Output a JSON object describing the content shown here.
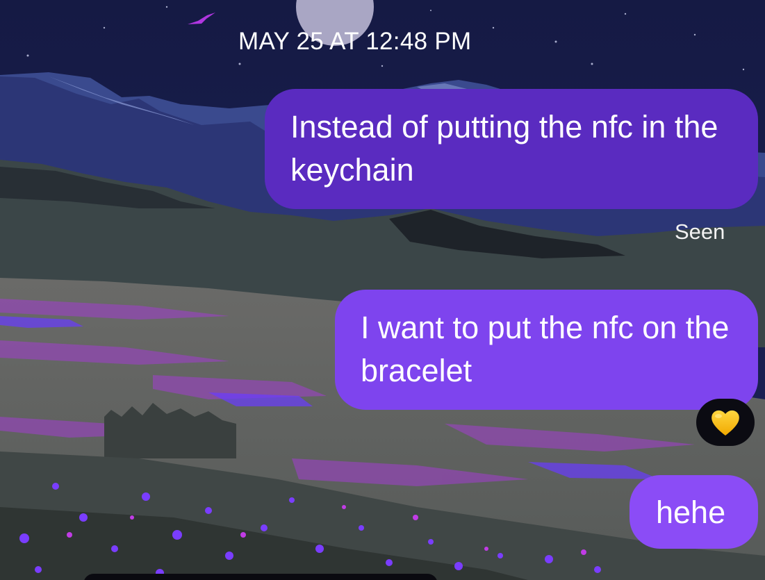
{
  "conversation": {
    "timestamp": "MAY 25 AT 12:48 PM",
    "messages": [
      {
        "text": "Instead of putting the nfc in the keychain",
        "color": "#5a2bc0"
      },
      {
        "text": "I want to put the nfc on the bracelet",
        "color": "#7e44ee",
        "reaction": "yellow-heart-icon"
      },
      {
        "text": "hehe",
        "color": "#8b4cf6"
      }
    ],
    "seen_label": "Seen"
  },
  "theme": {
    "sky": "#141a3e",
    "accent": "#7e44ee"
  }
}
